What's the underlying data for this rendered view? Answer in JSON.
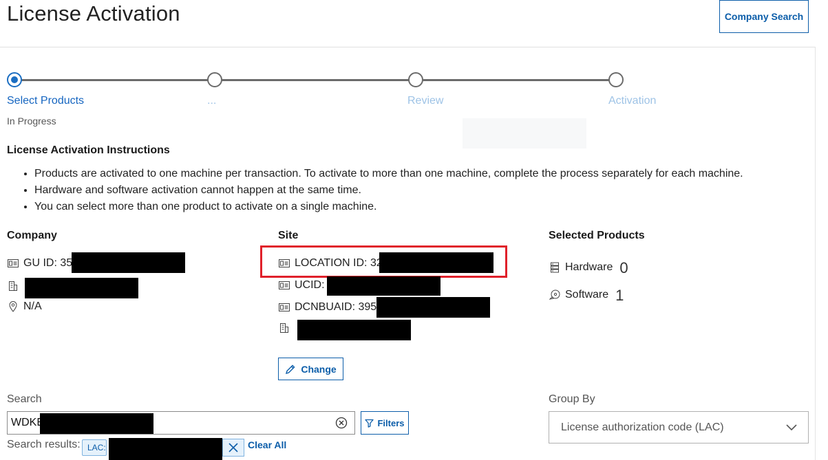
{
  "header": {
    "title": "License Activation",
    "company_search_label": "Company Search"
  },
  "stepper": {
    "steps": [
      {
        "label": "Select Products",
        "state": "active"
      },
      {
        "label": "...",
        "state": "pending"
      },
      {
        "label": "Review",
        "state": "pending"
      },
      {
        "label": "Activation",
        "state": "pending"
      }
    ],
    "status": "In Progress"
  },
  "instructions": {
    "title": "License Activation Instructions",
    "items": [
      "Products are activated to one machine per transaction. To activate to more than one machine, complete the process separately for each machine.",
      "Hardware and software activation cannot happen at the same time.",
      "You can select more than one product to activate on a single machine."
    ]
  },
  "company": {
    "title": "Company",
    "gu_id": "GU ID: 35",
    "location": "N/A"
  },
  "site": {
    "title": "Site",
    "location_id": "LOCATION ID: 32",
    "ucid": "UCID:",
    "dcnbuaid": "DCNBUAID: 3956",
    "change_label": "Change"
  },
  "selected_products": {
    "title": "Selected Products",
    "hardware_label": "Hardware",
    "hardware_count": "0",
    "software_label": "Software",
    "software_count": "1"
  },
  "search": {
    "label": "Search",
    "value": "WDKE",
    "filters_label": "Filters",
    "results_label": "Search results:",
    "chip_label": "LAC:",
    "clear_all_label": "Clear All"
  },
  "group_by": {
    "label": "Group By",
    "selected": "License authorization code (LAC)"
  },
  "colors": {
    "accent": "#0b5da9",
    "highlight": "#e0202a",
    "pending_step": "#9ec3e6"
  }
}
